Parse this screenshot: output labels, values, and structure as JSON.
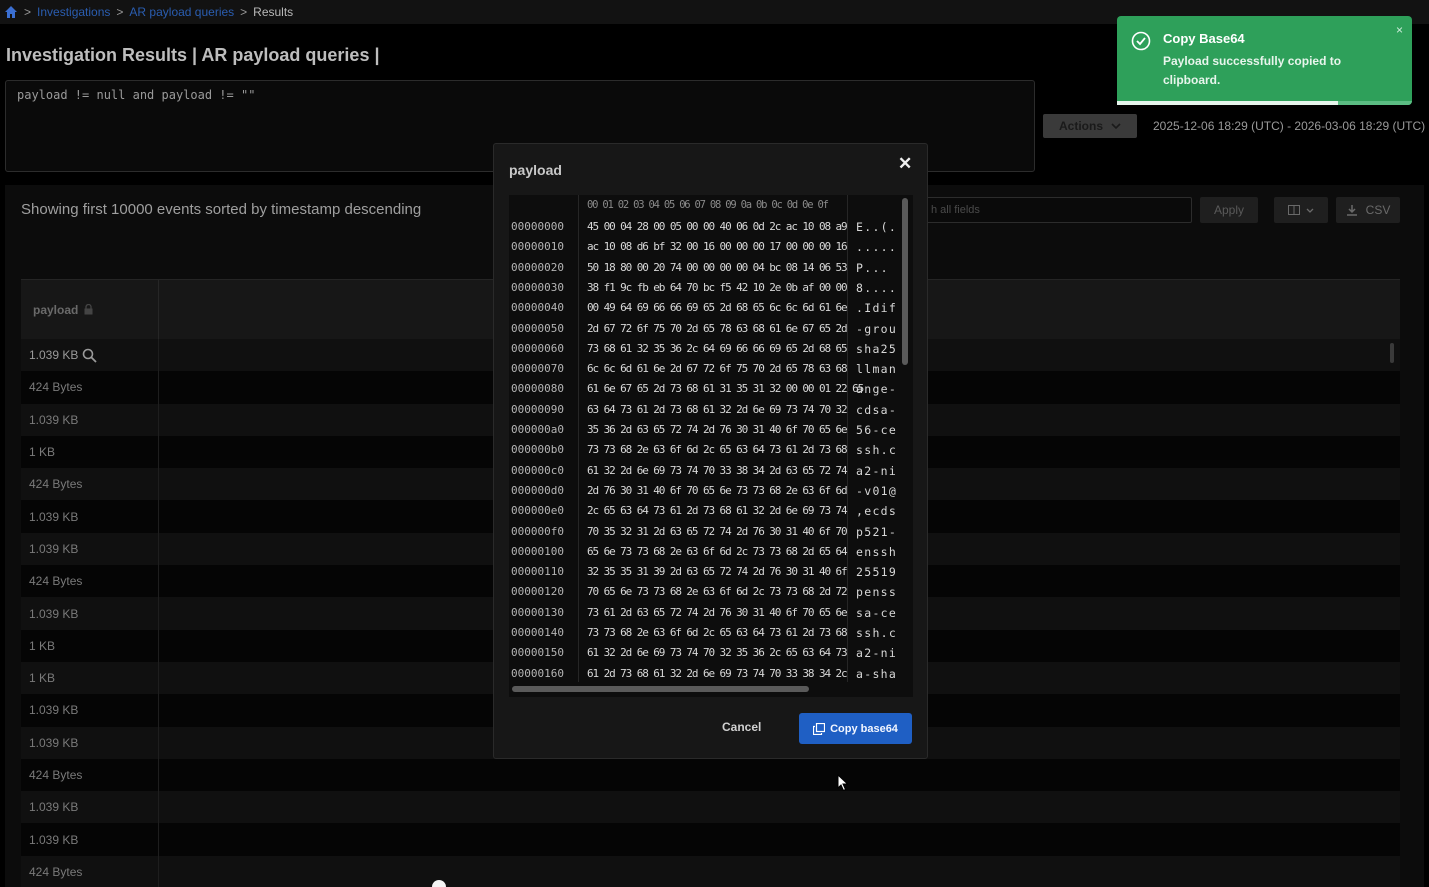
{
  "breadcrumb": {
    "items": [
      "Investigations",
      "AR payload queries",
      "Results"
    ],
    "sep": ">"
  },
  "page_title": "Investigation Results | AR payload queries |",
  "query": "payload != null and payload != \"\"",
  "actions_label": "Actions",
  "date_range": "2025-12-06 18:29 (UTC) - 2026-03-06 18:29 (UTC)",
  "showing_text": "Showing first 10000 events sorted by timestamp descending",
  "filter_placeholder": "h all fields",
  "apply_label": "Apply",
  "csv_label": "CSV",
  "table": {
    "column": "payload",
    "rows": [
      "1.039 KB",
      "424 Bytes",
      "1.039 KB",
      "1 KB",
      "424 Bytes",
      "1.039 KB",
      "1.039 KB",
      "424 Bytes",
      "1.039 KB",
      "1 KB",
      "1 KB",
      "1.039 KB",
      "1.039 KB",
      "424 Bytes",
      "1.039 KB",
      "1.039 KB",
      "424 Bytes"
    ]
  },
  "toast": {
    "title": "Copy Base64",
    "message_line1": "Payload successfully copied to",
    "message_line2": "clipboard.",
    "close": "×",
    "progress_fraction": 0.75
  },
  "modal": {
    "title": "payload",
    "close": "✕",
    "hex_header": "00 01 02 03 04 05 06 07 08 09 0a 0b 0c 0d 0e 0f",
    "hex_rows": [
      {
        "off": "00000000",
        "hex": "45 00 04 28 00 05 00 00 40 06 0d 2c ac 10 08 a9",
        "asc": "E..(."
      },
      {
        "off": "00000010",
        "hex": "ac 10 08 d6 bf 32 00 16 00 00 00 17 00 00 00 16",
        "asc": "....."
      },
      {
        "off": "00000020",
        "hex": "50 18 80 00 20 74 00 00 00 00 04 bc 08 14 06 53",
        "asc": "P..."
      },
      {
        "off": "00000030",
        "hex": "38 f1 9c fb eb 64 70 bc f5 42 10 2e 0b af 00 00",
        "asc": "8...."
      },
      {
        "off": "00000040",
        "hex": "00 49 64 69 66 66 69 65 2d 68 65 6c 6c 6d 61 6e",
        "asc": ".Idif"
      },
      {
        "off": "00000050",
        "hex": "2d 67 72 6f 75 70 2d 65 78 63 68 61 6e 67 65 2d",
        "asc": "-grou"
      },
      {
        "off": "00000060",
        "hex": "73 68 61 32 35 36 2c 64 69 66 66 69 65 2d 68 65",
        "asc": "sha25"
      },
      {
        "off": "00000070",
        "hex": "6c 6c 6d 61 6e 2d 67 72 6f 75 70 2d 65 78 63 68",
        "asc": "llman"
      },
      {
        "off": "00000080",
        "hex": "61 6e 67 65 2d 73 68 61 31 35 31 32 00 00 01 22 65",
        "asc": "ange-"
      },
      {
        "off": "00000090",
        "hex": "63 64 73 61 2d 73 68 61 32 2d 6e 69 73 74 70 32",
        "asc": "cdsa-"
      },
      {
        "off": "000000a0",
        "hex": "35 36 2d 63 65 72 74 2d 76 30 31 40 6f 70 65 6e",
        "asc": "56-ce"
      },
      {
        "off": "000000b0",
        "hex": "73 73 68 2e 63 6f 6d 2c 65 63 64 73 61 2d 73 68",
        "asc": "ssh.c"
      },
      {
        "off": "000000c0",
        "hex": "61 32 2d 6e 69 73 74 70 33 38 34 2d 63 65 72 74",
        "asc": "a2-ni"
      },
      {
        "off": "000000d0",
        "hex": "2d 76 30 31 40 6f 70 65 6e 73 73 68 2e 63 6f 6d",
        "asc": "-v01@"
      },
      {
        "off": "000000e0",
        "hex": "2c 65 63 64 73 61 2d 73 68 61 32 2d 6e 69 73 74",
        "asc": ",ecds"
      },
      {
        "off": "000000f0",
        "hex": "70 35 32 31 2d 63 65 72 74 2d 76 30 31 40 6f 70",
        "asc": "p521-"
      },
      {
        "off": "00000100",
        "hex": "65 6e 73 73 68 2e 63 6f 6d 2c 73 73 68 2d 65 64",
        "asc": "enssh"
      },
      {
        "off": "00000110",
        "hex": "32 35 35 31 39 2d 63 65 72 74 2d 76 30 31 40 6f",
        "asc": "25519"
      },
      {
        "off": "00000120",
        "hex": "70 65 6e 73 73 68 2e 63 6f 6d 2c 73 73 68 2d 72",
        "asc": "penss"
      },
      {
        "off": "00000130",
        "hex": "73 61 2d 63 65 72 74 2d 76 30 31 40 6f 70 65 6e",
        "asc": "sa-ce"
      },
      {
        "off": "00000140",
        "hex": "73 73 68 2e 63 6f 6d 2c 65 63 64 73 61 2d 73 68",
        "asc": "ssh.c"
      },
      {
        "off": "00000150",
        "hex": "61 32 2d 6e 69 73 74 70 32 35 36 2c 65 63 64 73",
        "asc": "a2-ni"
      },
      {
        "off": "00000160",
        "hex": "61 2d 73 68 61 32 2d 6e 69 73 74 70 33 38 34 2c",
        "asc": "a-sha"
      }
    ],
    "cancel_label": "Cancel",
    "copy_label": "Copy base64"
  },
  "colors": {
    "toast_green": "#2ea05a",
    "primary_blue": "#1f5fc4",
    "link_blue": "#2a5db0"
  }
}
